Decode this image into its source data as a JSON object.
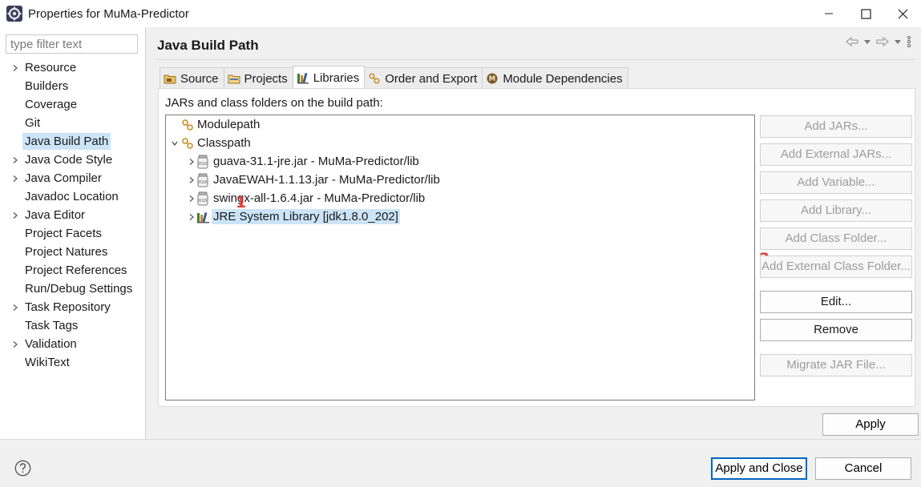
{
  "window": {
    "title": "Properties for MuMa-Predictor"
  },
  "filter": {
    "placeholder": "type filter text"
  },
  "nav": {
    "items": [
      {
        "label": "Resource",
        "expandable": true
      },
      {
        "label": "Builders",
        "expandable": false
      },
      {
        "label": "Coverage",
        "expandable": false
      },
      {
        "label": "Git",
        "expandable": false
      },
      {
        "label": "Java Build Path",
        "expandable": false,
        "selected": true
      },
      {
        "label": "Java Code Style",
        "expandable": true
      },
      {
        "label": "Java Compiler",
        "expandable": true
      },
      {
        "label": "Javadoc Location",
        "expandable": false
      },
      {
        "label": "Java Editor",
        "expandable": true
      },
      {
        "label": "Project Facets",
        "expandable": false
      },
      {
        "label": "Project Natures",
        "expandable": false
      },
      {
        "label": "Project References",
        "expandable": false
      },
      {
        "label": "Run/Debug Settings",
        "expandable": false
      },
      {
        "label": "Task Repository",
        "expandable": true
      },
      {
        "label": "Task Tags",
        "expandable": false
      },
      {
        "label": "Validation",
        "expandable": true
      },
      {
        "label": "WikiText",
        "expandable": false
      }
    ]
  },
  "page": {
    "title": "Java Build Path",
    "section_label": "JARs and class folders on the build path:"
  },
  "tabs": [
    {
      "label": "Source",
      "icon": "source-folder-icon"
    },
    {
      "label": "Projects",
      "icon": "projects-icon"
    },
    {
      "label": "Libraries",
      "icon": "libraries-icon",
      "active": true
    },
    {
      "label": "Order and Export",
      "icon": "order-export-icon"
    },
    {
      "label": "Module Dependencies",
      "icon": "module-dependencies-icon"
    }
  ],
  "tree": {
    "modulepath": "Modulepath",
    "classpath": "Classpath",
    "entries": [
      {
        "label": "guava-31.1-jre.jar - MuMa-Predictor/lib",
        "icon": "jar-icon"
      },
      {
        "label": "JavaEWAH-1.1.13.jar - MuMa-Predictor/lib",
        "icon": "jar-icon"
      },
      {
        "label": "swingx-all-1.6.4.jar - MuMa-Predictor/lib",
        "icon": "jar-icon"
      },
      {
        "label": "JRE System Library [jdk1.8.0_202]",
        "icon": "library-icon",
        "selected": true
      }
    ]
  },
  "annotations": {
    "marker1": "1",
    "marker2": "2"
  },
  "buttons": {
    "add_jars": "Add JARs...",
    "add_external_jars": "Add External JARs...",
    "add_variable": "Add Variable...",
    "add_library": "Add Library...",
    "add_class_folder": "Add Class Folder...",
    "add_external_class_folder": "Add External Class Folder...",
    "edit": "Edit...",
    "remove": "Remove",
    "migrate_jar": "Migrate JAR File...",
    "apply": "Apply",
    "apply_and_close": "Apply and Close",
    "cancel": "Cancel"
  },
  "colors": {
    "selection": "#cce4f7",
    "marker": "#e03c3c",
    "primary_border": "#0067c0"
  }
}
